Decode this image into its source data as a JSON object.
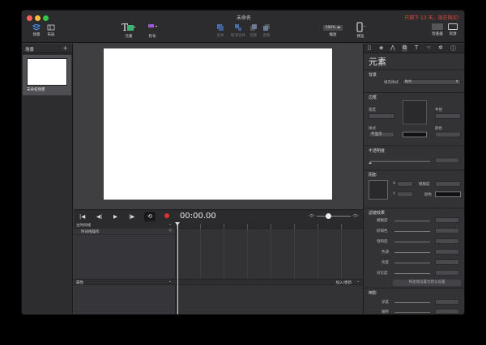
{
  "window": {
    "title": "未命名",
    "promo": "只剩下 13 天，现在购买!"
  },
  "toolbar": {
    "left": [
      {
        "label": "场景",
        "icon": "scenes-icon"
      },
      {
        "label": "布局",
        "icon": "layout-icon"
      }
    ],
    "center": [
      {
        "label": "元素",
        "icon": "text-element-icon"
      },
      {
        "label": "符号",
        "icon": "symbol-icon"
      }
    ],
    "disabled": [
      {
        "label": "合并",
        "icon": "merge-icon"
      },
      {
        "label": "取消合并",
        "icon": "unmerge-icon"
      },
      {
        "label": "前移",
        "icon": "forward-icon"
      },
      {
        "label": "后移",
        "icon": "backward-icon"
      }
    ],
    "zoom": {
      "value": "100%",
      "label": "缩放"
    },
    "preview": {
      "label": "预览"
    },
    "right": [
      {
        "label": "检查器",
        "icon": "inspector-icon"
      },
      {
        "label": "资源",
        "icon": "library-icon"
      }
    ]
  },
  "sidebar": {
    "title": "场景",
    "add": "+",
    "scenes": [
      {
        "name": "未命名场景"
      }
    ]
  },
  "transport": {
    "timecode": "00:00.00"
  },
  "timeline": {
    "main_label": "主时间线",
    "action_label": "时间线操作",
    "ruler_marks": [
      "0",
      "1",
      "2",
      "3",
      "4",
      "5",
      "6",
      "7",
      "8"
    ],
    "attributes_label": "属性",
    "add_keyframe_label": "加入/更新"
  },
  "inspector": {
    "title": "元素",
    "background": {
      "title": "背景",
      "fill_label": "填充样式",
      "fill_value": "N/A"
    },
    "border": {
      "title": "边框",
      "width_label": "宽度",
      "radius_label": "半径",
      "style_label": "样式",
      "style_value": "不显示",
      "color_label": "颜色"
    },
    "opacity": {
      "title": "不透明度"
    },
    "shadow": {
      "title": "阴影",
      "x_label": "X",
      "y_label": "Y",
      "blur_label": "模糊度",
      "color_label": "颜色"
    },
    "filters": {
      "title": "滤镜效果",
      "items": [
        "模糊度",
        "棕褐色",
        "饱和度",
        "色调",
        "亮度",
        "对比度"
      ],
      "reset_button": "将滤镜设置为默认设置"
    },
    "reflection": {
      "title": "倒影",
      "items": [
        "深度",
        "偏移"
      ]
    }
  },
  "colors": {
    "promo": "#e8483a",
    "record": "#d6362d"
  }
}
